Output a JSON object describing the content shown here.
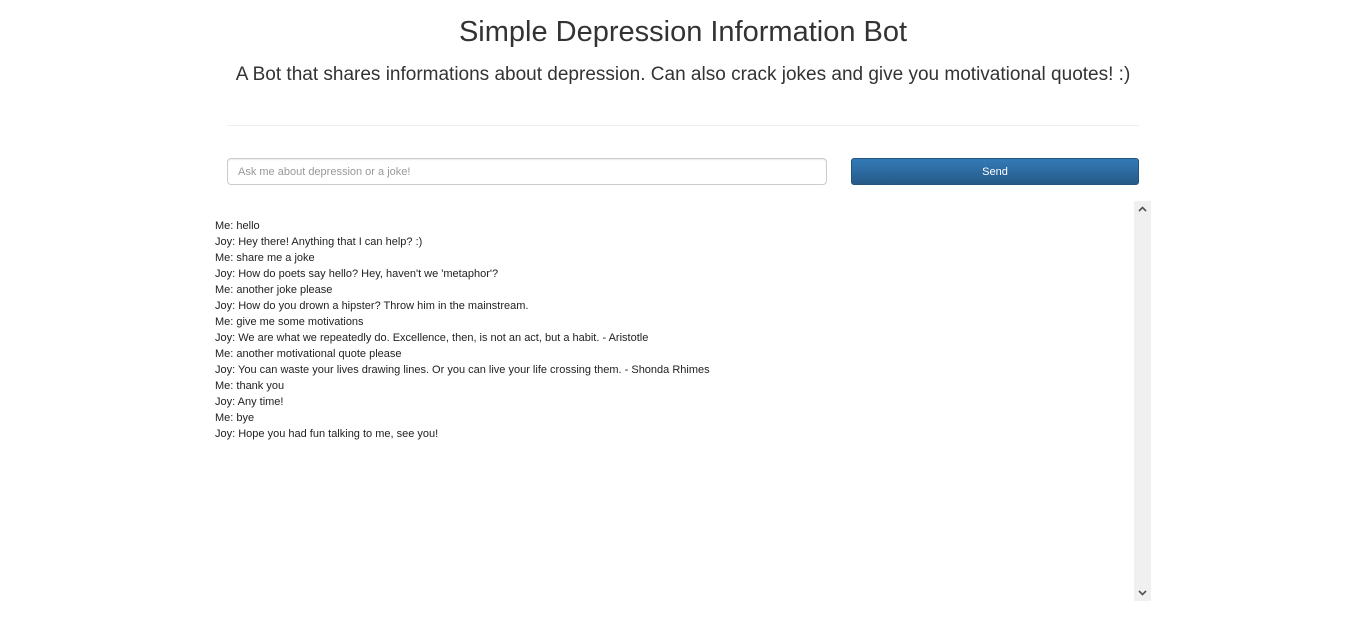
{
  "header": {
    "title": "Simple Depression Information Bot",
    "subtitle": "A Bot that shares informations about depression. Can also crack jokes and give you motivational quotes! :)"
  },
  "chat_form": {
    "input_value": "",
    "input_placeholder": "Ask me about depression or a joke!",
    "send_label": "Send"
  },
  "colors": {
    "send_button": "#337ab7",
    "scrollbar_track": "#f0f0f0"
  },
  "chat_log": {
    "messages": [
      "Me: hello",
      "Joy: Hey there! Anything that I can help? :)",
      "Me: share me a joke",
      "Joy: How do poets say hello? Hey, haven't we 'metaphor'?",
      "Me: another joke please",
      "Joy: How do you drown a hipster? Throw him in the mainstream.",
      "Me: give me some motivations",
      "Joy: We are what we repeatedly do. Excellence, then, is not an act, but a habit. - Aristotle",
      "Me: another motivational quote please",
      "Joy: You can waste your lives drawing lines. Or you can live your life crossing them. - Shonda Rhimes",
      "Me: thank you",
      "Joy: Any time!",
      "Me: bye",
      "Joy: Hope you had fun talking to me, see you!"
    ],
    "scroll_up_icon": "chevron-up-icon",
    "scroll_down_icon": "chevron-down-icon"
  }
}
